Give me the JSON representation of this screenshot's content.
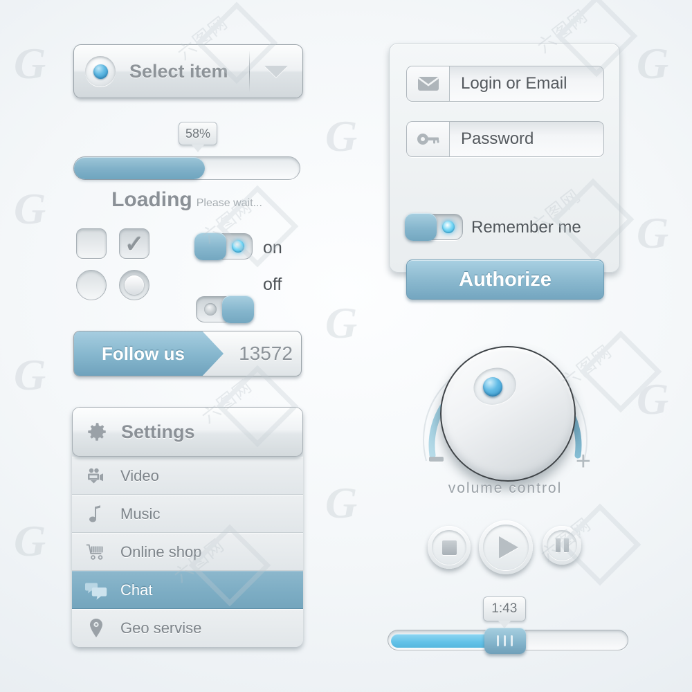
{
  "theme": {
    "accent_blue": "#85b6cd",
    "accent_blue_bright": "#63c2e8",
    "background": "#f2f5f7",
    "text_gray": "#8b9197"
  },
  "select_item": {
    "label": "Select item",
    "bullet_icon": "blue-dot-icon",
    "arrow_icon": "chevron-down-icon"
  },
  "progress": {
    "tooltip": "58%",
    "percent": 58,
    "loading_title": "Loading",
    "loading_subtitle": "Please wait..."
  },
  "controls": {
    "checkbox_unchecked_label": "",
    "checkbox_checked_glyph": "✓",
    "toggle_on_label": "on",
    "toggle_off_label": "off"
  },
  "follow": {
    "label": "Follow us",
    "count": "13572"
  },
  "menu": {
    "header": {
      "label": "Settings",
      "icon": "gear-icon"
    },
    "items": [
      {
        "label": "Video",
        "icon": "video-camera-icon",
        "active": false
      },
      {
        "label": "Music",
        "icon": "music-note-icon",
        "active": false
      },
      {
        "label": "Online shop",
        "icon": "shopping-cart-icon",
        "active": false
      },
      {
        "label": "Chat",
        "icon": "chat-bubbles-icon",
        "active": true
      },
      {
        "label": "Geo servise",
        "icon": "map-pin-icon",
        "active": false
      }
    ]
  },
  "login": {
    "email_value": "Login or Email",
    "email_icon": "envelope-icon",
    "password_value": "Password",
    "password_icon": "key-icon",
    "remember_label": "Remember me",
    "remember_on": true,
    "authorize_label": "Authorize"
  },
  "volume": {
    "caption": "volume control",
    "minus_label": "−",
    "plus_label": "+",
    "level_percent": 72
  },
  "player": {
    "stop_icon": "stop-icon",
    "play_icon": "play-icon",
    "pause_icon": "pause-icon",
    "time_tooltip": "1:43",
    "progress_percent": 42
  },
  "watermarks": {
    "glyph": "G",
    "cn_text": "六图网"
  }
}
